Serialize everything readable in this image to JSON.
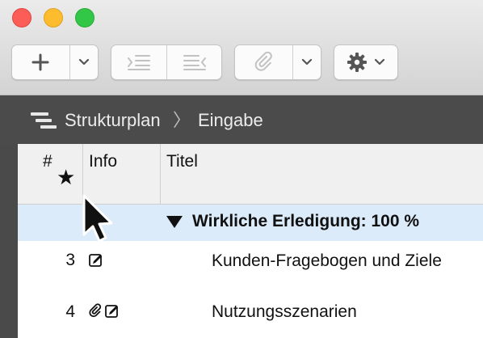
{
  "window": {
    "traffic_lights": [
      "close",
      "minimize",
      "zoom"
    ],
    "colors": {
      "close": "#fc5e57",
      "minimize": "#fdbc2e",
      "zoom": "#33c748"
    }
  },
  "toolbar": {
    "groups": [
      {
        "name": "add",
        "buttons": [
          "plus-icon",
          "chevron-down-icon"
        ]
      },
      {
        "name": "indent",
        "buttons": [
          "indent-icon",
          "outdent-icon"
        ],
        "enabled": false
      },
      {
        "name": "attach",
        "buttons": [
          "paperclip-icon",
          "chevron-down-icon"
        ]
      },
      {
        "name": "settings",
        "buttons": [
          "gear-icon",
          "chevron-down-icon"
        ]
      }
    ]
  },
  "breadcrumb": {
    "icon": "structure-plan-icon",
    "items": [
      "Strukturplan",
      "Eingabe"
    ],
    "separator": "〉"
  },
  "table": {
    "columns": {
      "number": "#",
      "number_sub": "★",
      "info": "Info",
      "title": "Titel"
    },
    "group": {
      "title": "Wirkliche Erledigung: 100 %",
      "expanded": true,
      "highlight": "#dcebfa"
    },
    "rows": [
      {
        "number": "3",
        "icons": [
          "note-icon"
        ],
        "title": "Kunden-Fragebogen und Ziele"
      },
      {
        "number": "4",
        "icons": [
          "paperclip-icon",
          "note-icon"
        ],
        "title": "Nutzungsszenarien"
      }
    ]
  }
}
